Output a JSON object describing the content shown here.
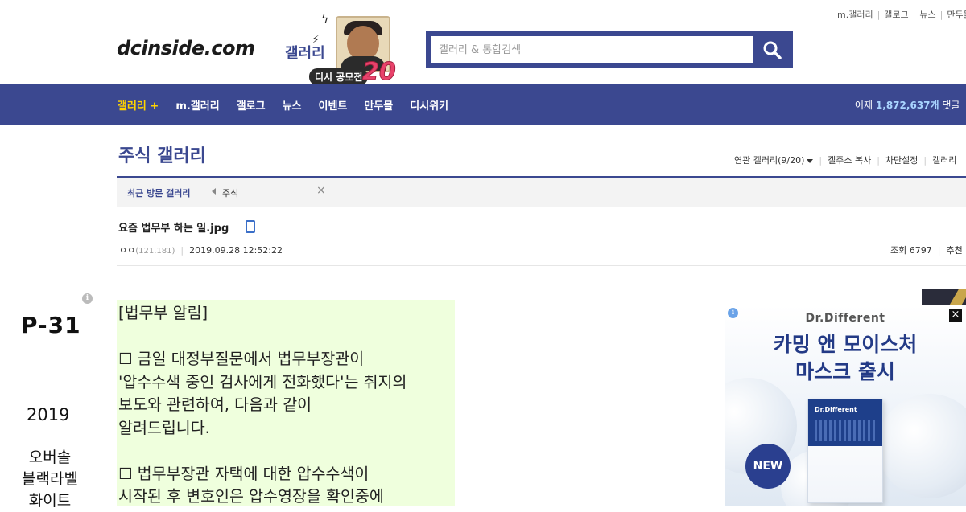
{
  "util_links": [
    "m.갤러리",
    "갤로그",
    "뉴스",
    "만두몰"
  ],
  "logo": {
    "text": "dcinside.com",
    "sub": "갤러리"
  },
  "promo": {
    "pill": "디시 공모전",
    "number": "20"
  },
  "search": {
    "placeholder": "갤러리 & 통합검색",
    "value": ""
  },
  "nav": {
    "items": [
      "갤러리 +",
      "m.갤러리",
      "갤로그",
      "뉴스",
      "이벤트",
      "만두몰",
      "디시위키"
    ],
    "stats_prefix": "어제",
    "stats_value": "1,872,637개",
    "stats_suffix": "댓글"
  },
  "gallery": {
    "title": "주식 갤러리",
    "tools": [
      "연관 갤러리(9/20)",
      "갤주소 복사",
      "차단설정",
      "갤러리"
    ]
  },
  "recent": {
    "label": "최근 방문 갤러리",
    "chip": "주식",
    "close": "×"
  },
  "post": {
    "title": "요즘 법무부 하는 일.jpg",
    "author": "ㅇㅇ",
    "ip": "(121.181)",
    "date": "2019.09.28 12:52:22",
    "views_label": "조회 6797",
    "recommend_label": "추천"
  },
  "left_ad": {
    "info": "i",
    "code": "P-31",
    "year": "2019",
    "name_lines": [
      "오버솔",
      "블랙라벨",
      "화이트"
    ]
  },
  "post_image_lines": [
    "[법무부 알림]",
    "",
    "☐ 금일 대정부질문에서 법무부장관이",
    "'압수수색 중인 검사에게 전화했다'는 취지의",
    "보도와 관련하여, 다음과 같이",
    "알려드립니다.",
    "",
    "☐ 법무부장관 자택에 대한 압수수색이",
    "시작된 후 변호인은 압수영장을 확인중에"
  ],
  "right_ad": {
    "info": "i",
    "brand": "Dr.Different",
    "headline_1": "카밍 앤 모이스처",
    "headline_2": "마스크 출시",
    "box_brand": "Dr.Different",
    "badge": "NEW",
    "close": "×"
  },
  "colors": {
    "brand_blue": "#3b4890",
    "nav_highlight": "#ffd400",
    "post_image_bg": "#efffdd",
    "ad_navy": "#233a86"
  }
}
